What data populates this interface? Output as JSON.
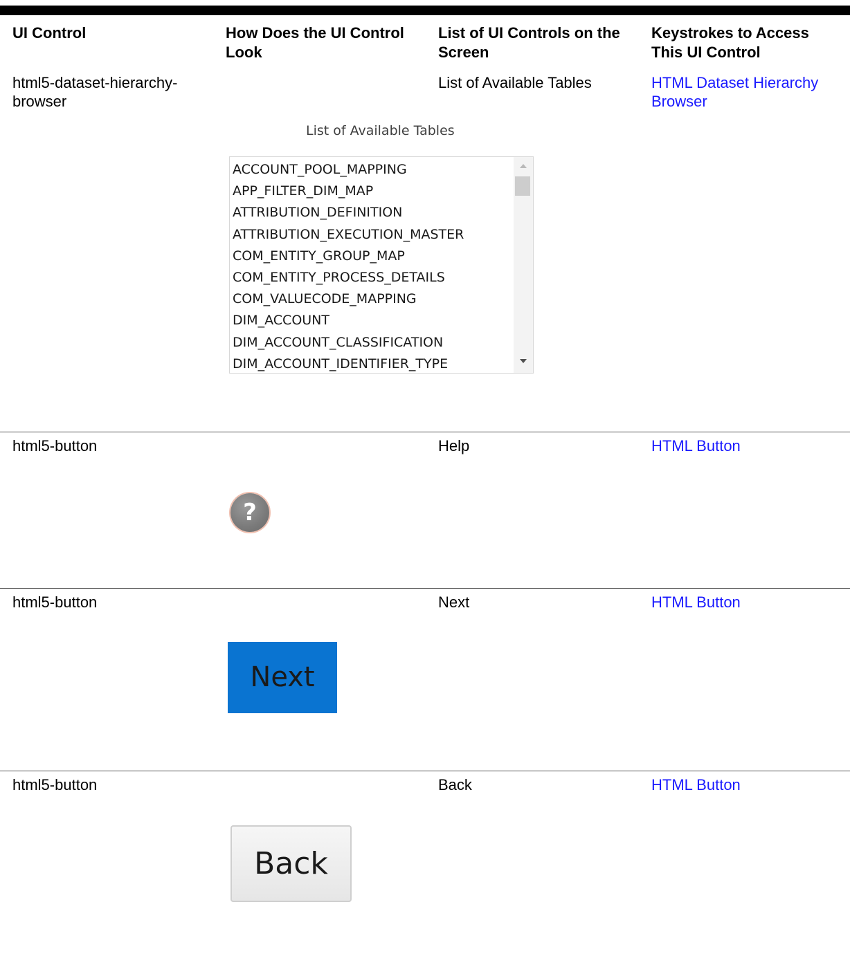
{
  "table": {
    "headers": [
      [
        "UI Control"
      ],
      [
        "How Does the UI Control",
        "Look"
      ],
      [
        "List of UI Controls on the",
        "Screen"
      ],
      [
        "Keystrokes to Access",
        "This UI Control"
      ]
    ],
    "rows": [
      {
        "control_lines": [
          "html5-dataset-hierarchy-",
          "browser"
        ],
        "screen_control": "List of Available Tables",
        "keystroke_link_lines": [
          "HTML Dataset Hierarchy",
          "Browser"
        ]
      },
      {
        "control_lines": [
          "html5-button"
        ],
        "screen_control": "Help",
        "keystroke_link_lines": [
          "HTML Button"
        ]
      },
      {
        "control_lines": [
          "html5-button"
        ],
        "screen_control": "Next",
        "keystroke_link_lines": [
          "HTML Button"
        ]
      },
      {
        "control_lines": [
          "html5-button"
        ],
        "screen_control": "Back",
        "keystroke_link_lines": [
          "HTML Button"
        ]
      }
    ]
  },
  "listbox": {
    "caption": "List of Available Tables",
    "items": [
      "ACCOUNT_POOL_MAPPING",
      "APP_FILTER_DIM_MAP",
      "ATTRIBUTION_DEFINITION",
      "ATTRIBUTION_EXECUTION_MASTER",
      "COM_ENTITY_GROUP_MAP",
      "COM_ENTITY_PROCESS_DETAILS",
      "COM_VALUECODE_MAPPING",
      "DIM_ACCOUNT",
      "DIM_ACCOUNT_CLASSIFICATION",
      "DIM_ACCOUNT_IDENTIFIER_TYPE"
    ]
  },
  "help_icon": {
    "icon": "help-icon",
    "glyph": "?"
  },
  "next_button": {
    "label": "Next",
    "color": "#0a74d1"
  },
  "back_button": {
    "label": "Back"
  },
  "colors": {
    "link": "#1a1aff",
    "top_rule": "#000000"
  }
}
